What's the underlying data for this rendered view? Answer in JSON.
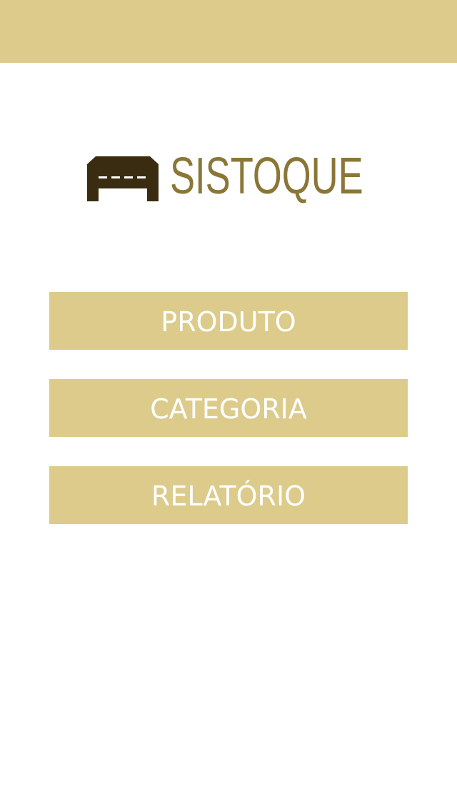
{
  "header": {
    "background_color": "#dccb8b"
  },
  "logo": {
    "icon": "warehouse-icon",
    "icon_color": "#3a2c10",
    "text": "SISTOQUE",
    "text_color": "#8a7636"
  },
  "menu": {
    "button_color": "#dccb8b",
    "text_color": "#ffffff",
    "items": [
      {
        "label": "PRODUTO"
      },
      {
        "label": "CATEGORIA"
      },
      {
        "label": "RELATÓRIO"
      }
    ]
  }
}
